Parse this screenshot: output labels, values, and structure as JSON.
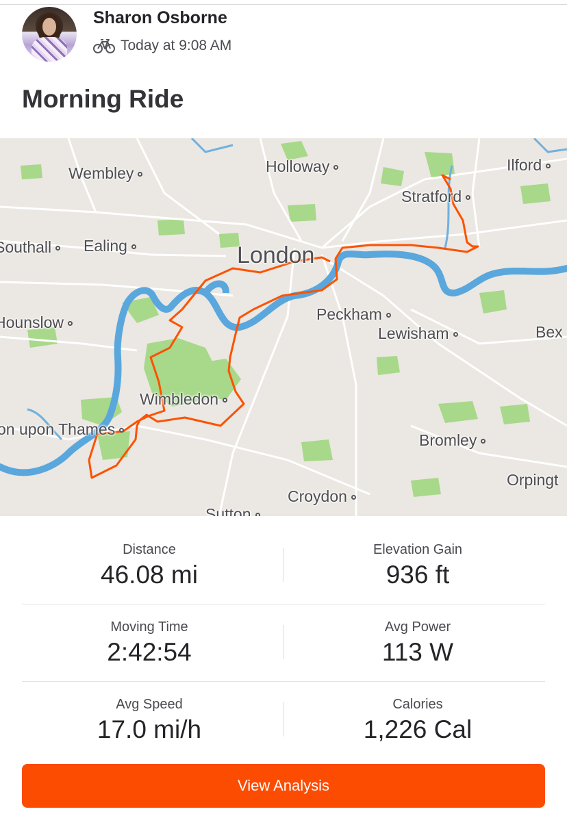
{
  "athlete": {
    "name": "Sharon Osborne",
    "activity_type_icon": "bike-icon",
    "time": "Today at 9:08 AM"
  },
  "activity": {
    "title": "Morning Ride"
  },
  "map": {
    "route_color": "#fc5200",
    "river_color": "#5aa7dd",
    "park_color": "#a8d88a",
    "places": {
      "wembley": "Wembley",
      "holloway": "Holloway",
      "ilford": "Ilford",
      "stratford": "Stratford",
      "southall": "Southall",
      "ealing": "Ealing",
      "london": "London",
      "hounslow": "Hounslow",
      "peckham": "Peckham",
      "lewisham": "Lewisham",
      "bexley": "Bex",
      "wimbledon": "Wimbledon",
      "kingston": "on upon Thames",
      "bromley": "Bromley",
      "orpington": "Orpingt",
      "croydon": "Croydon",
      "sutton": "Sutton"
    }
  },
  "stats": {
    "distance": {
      "label": "Distance",
      "value": "46.08 mi"
    },
    "elevation_gain": {
      "label": "Elevation Gain",
      "value": "936 ft"
    },
    "moving_time": {
      "label": "Moving Time",
      "value": "2:42:54"
    },
    "avg_power": {
      "label": "Avg Power",
      "value": "113 W"
    },
    "avg_speed": {
      "label": "Avg Speed",
      "value": "17.0 mi/h"
    },
    "calories": {
      "label": "Calories",
      "value": "1,226 Cal"
    }
  },
  "actions": {
    "view_analysis_label": "View Analysis",
    "accent_color": "#fc4c02"
  }
}
